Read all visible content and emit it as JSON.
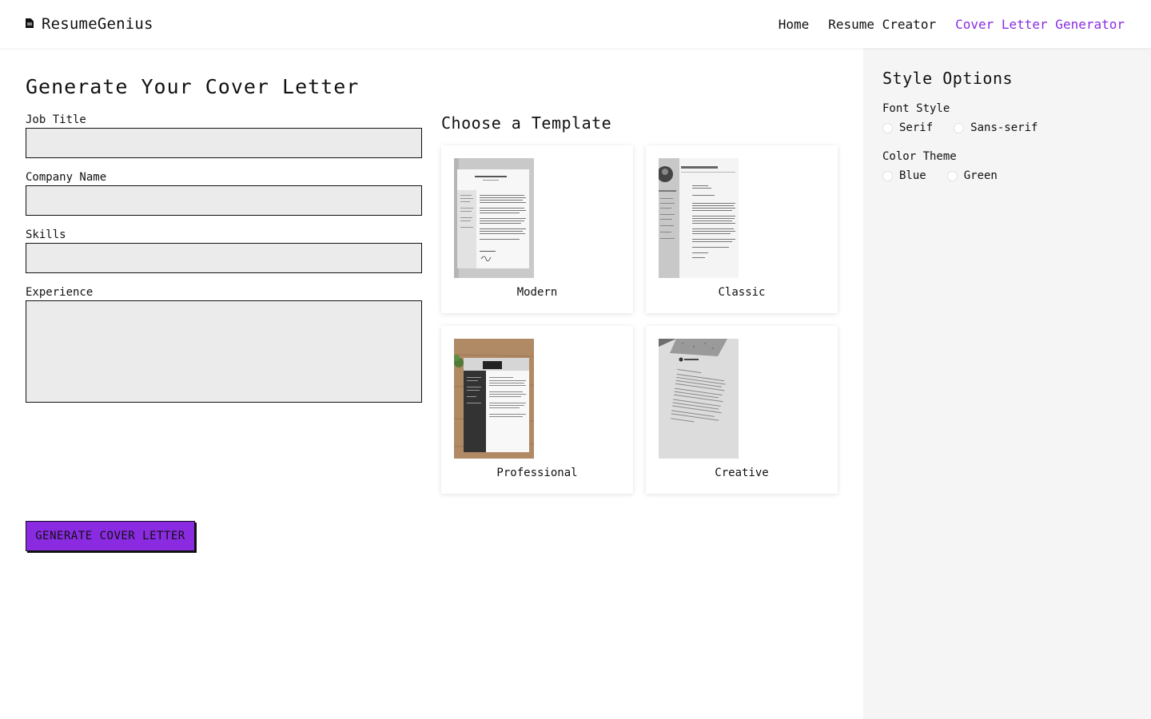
{
  "header": {
    "brand": "ResumeGenius",
    "nav": [
      {
        "label": "Home",
        "active": false
      },
      {
        "label": "Resume Creator",
        "active": false
      },
      {
        "label": "Cover Letter Generator",
        "active": true
      }
    ]
  },
  "main": {
    "title": "Generate Your Cover Letter",
    "fields": {
      "job_title": {
        "label": "Job Title",
        "value": "",
        "placeholder": ""
      },
      "company_name": {
        "label": "Company Name",
        "value": "",
        "placeholder": ""
      },
      "skills": {
        "label": "Skills",
        "value": "",
        "placeholder": ""
      },
      "experience": {
        "label": "Experience",
        "value": "",
        "placeholder": ""
      }
    },
    "generate_button": "GENERATE COVER LETTER"
  },
  "templates": {
    "heading": "Choose a Template",
    "items": [
      {
        "name": "Modern"
      },
      {
        "name": "Classic"
      },
      {
        "name": "Professional"
      },
      {
        "name": "Creative"
      }
    ]
  },
  "sidebar": {
    "heading": "Style Options",
    "font_style": {
      "label": "Font Style",
      "options": [
        "Serif",
        "Sans-serif"
      ]
    },
    "color_theme": {
      "label": "Color Theme",
      "options": [
        "Blue",
        "Green"
      ]
    }
  },
  "colors": {
    "accent": "#8a2be2",
    "input_bg": "#ebebeb",
    "sidebar_bg": "#f5f5f5"
  },
  "icons": {
    "brand": "document-icon"
  }
}
